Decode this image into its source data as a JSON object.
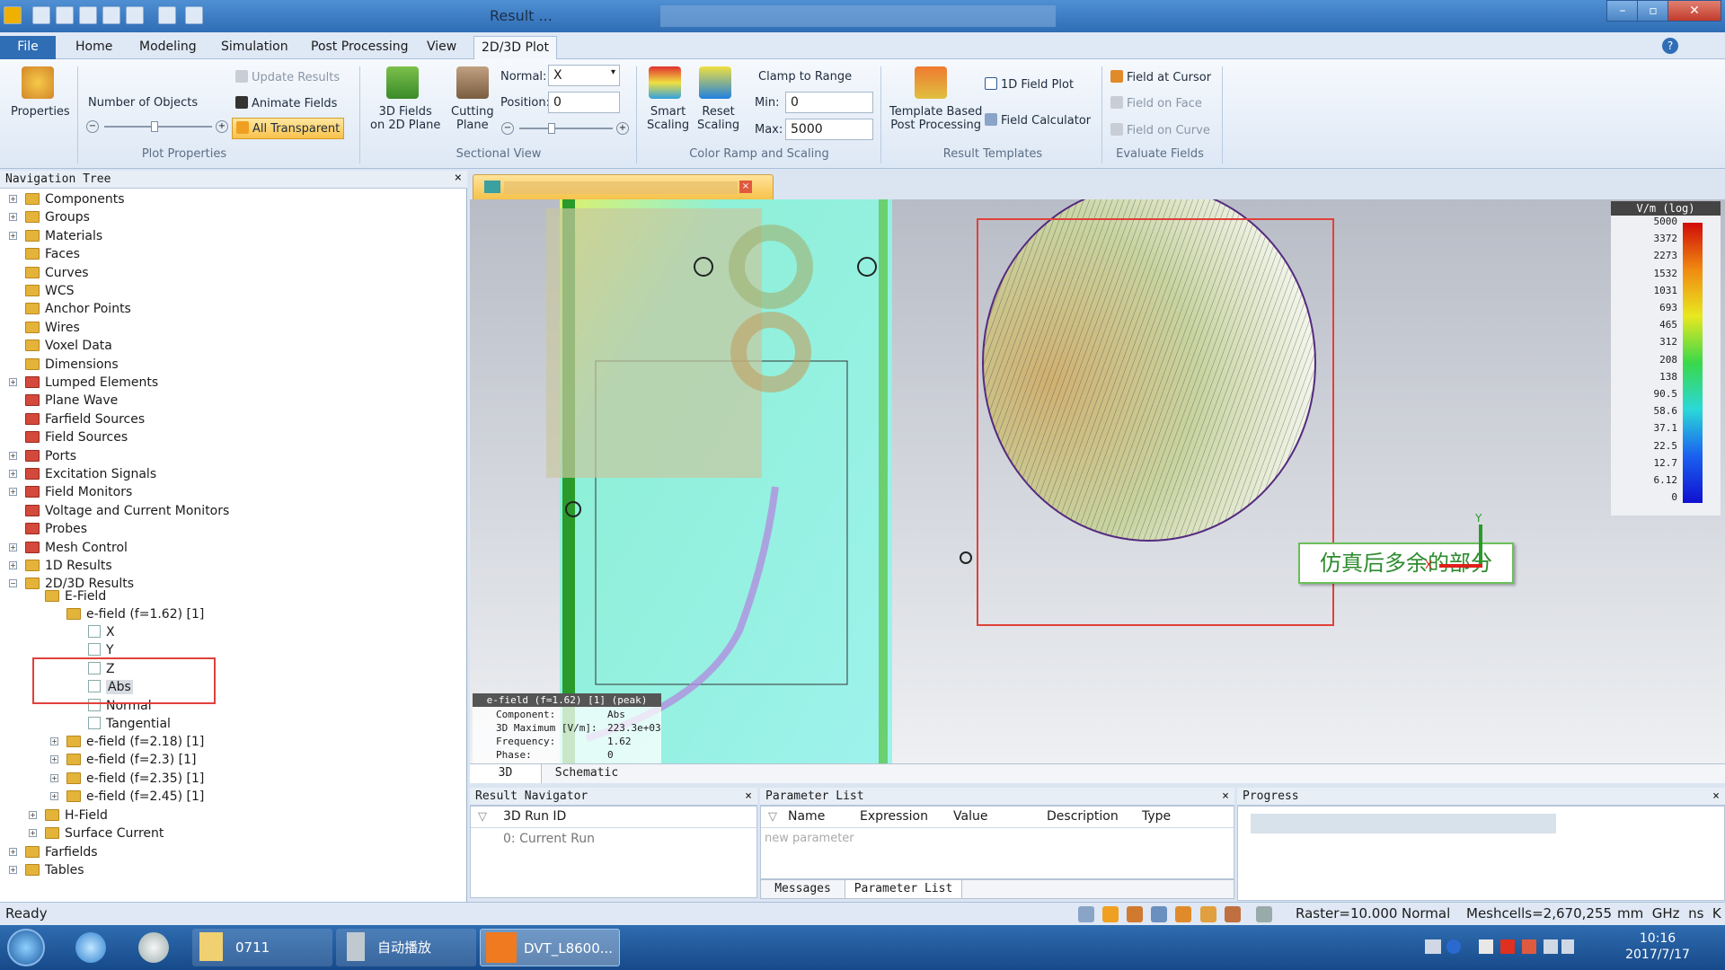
{
  "window": {
    "title": "Result ..."
  },
  "ribbon_tabs": [
    "File",
    "Home",
    "Modeling",
    "Simulation",
    "Post Processing",
    "View",
    "2D/3D Plot"
  ],
  "ribbon": {
    "properties": "Properties",
    "number_of_objects": "Number of Objects",
    "update_results": "Update Results",
    "animate_fields": "Animate Fields",
    "all_transparent": "All Transparent",
    "plot_properties": "Plot Properties",
    "fields_on_plane": "3D Fields\non 2D Plane",
    "cutting_plane": "Cutting\nPlane",
    "normal_label": "Normal:",
    "normal_value": "X",
    "position_label": "Position:",
    "position_value": "0",
    "sectional_view": "Sectional View",
    "smart_scaling": "Smart\nScaling",
    "reset_scaling": "Reset\nScaling",
    "clamp_to_range": "Clamp to Range",
    "min_label": "Min:",
    "min_value": "0",
    "max_label": "Max:",
    "max_value": "5000",
    "color_ramp": "Color Ramp and Scaling",
    "template_pp": "Template Based\nPost Processing",
    "field_plot_1d": "1D Field Plot",
    "field_calculator": "Field Calculator",
    "result_templates": "Result Templates",
    "field_at_cursor": "Field at Cursor",
    "field_on_face": "Field on Face",
    "field_on_curve": "Field on Curve",
    "evaluate_fields": "Evaluate Fields"
  },
  "nav": {
    "header": "Navigation Tree",
    "items": [
      "Components",
      "Groups",
      "Materials",
      "Faces",
      "Curves",
      "WCS",
      "Anchor Points",
      "Wires",
      "Voxel Data",
      "Dimensions",
      "Lumped Elements",
      "Plane Wave",
      "Farfield Sources",
      "Field Sources",
      "Ports",
      "Excitation Signals",
      "Field Monitors",
      "Voltage and Current Monitors",
      "Probes",
      "Mesh Control",
      "1D Results",
      "2D/3D Results"
    ],
    "efield": "E-Field",
    "ef162": "e-field (f=1.62) [1]",
    "components": [
      "X",
      "Y",
      "Z",
      "Abs",
      "Normal",
      "Tangential"
    ],
    "more_ef": [
      "e-field (f=2.18) [1]",
      "e-field (f=2.3) [1]",
      "e-field (f=2.35) [1]",
      "e-field (f=2.45) [1]"
    ],
    "tail": [
      "H-Field",
      "Surface Current",
      "Farfields",
      "Tables"
    ]
  },
  "legend": {
    "title": "V/m (log)",
    "ticks": [
      "5000",
      "3372",
      "2273",
      "1532",
      "1031",
      "693",
      "465",
      "312",
      "208",
      "138",
      "90.5",
      "58.6",
      "37.1",
      "22.5",
      "12.7",
      "6.12",
      "0"
    ]
  },
  "annotation": "仿真后多余的部分",
  "info": {
    "title": "e-field (f=1.62) [1] (peak)",
    "rows": [
      [
        "Component:",
        "Abs"
      ],
      [
        "3D Maximum [V/m]:",
        "223.3e+03"
      ],
      [
        "Frequency:",
        "1.62"
      ],
      [
        "Phase:",
        "0"
      ]
    ]
  },
  "axes": {
    "y": "Y",
    "x": "X"
  },
  "view_tabs": [
    "3D",
    "Schematic"
  ],
  "result_navigator": {
    "title": "Result Navigator",
    "col": "3D Run ID",
    "row": "0: Current Run"
  },
  "parameter_list": {
    "title": "Parameter List",
    "cols": [
      "Name",
      "Expression",
      "Value",
      "Description",
      "Type"
    ],
    "placeholder": "new parameter",
    "tabs": [
      "Messages",
      "Parameter List"
    ]
  },
  "progress": {
    "title": "Progress"
  },
  "status": {
    "ready": "Ready",
    "raster": "Raster=10.000",
    "mode": "Normal",
    "meshcells": "Meshcells=2,670,255",
    "units": "mm  GHz  ns  K"
  },
  "taskbar": {
    "items": [
      "0711",
      "自动播放",
      "DVT_L8600..."
    ],
    "time": "10:16",
    "date": "2017/7/17"
  },
  "colors": {
    "accent": "#2f6db5",
    "annotation_border": "#e0413b",
    "annotation_text": "#2e8b2e"
  }
}
